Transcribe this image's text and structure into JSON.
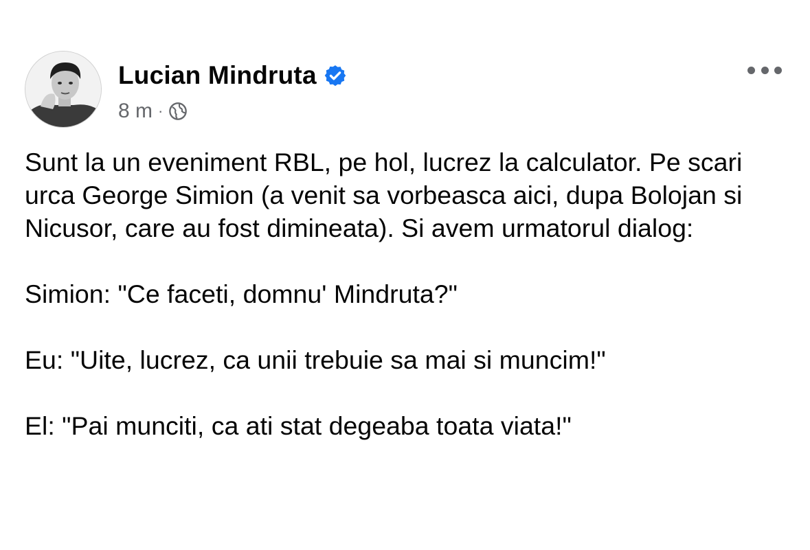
{
  "post": {
    "author": {
      "name": "Lucian Mindruta",
      "verified": true,
      "avatar_icon": "profile-photo"
    },
    "meta": {
      "time": "8 m",
      "separator": "·",
      "audience_icon": "globe-icon"
    },
    "more_icon": "more-options-icon",
    "paragraphs": [
      "Sunt la un eveniment RBL, pe hol, lucrez la calculator. Pe scari urca George Simion (a venit sa vorbeasca aici, dupa Bolojan si Nicusor, care au fost dimineata). Si avem urmatorul dialog:",
      "Simion: \"Ce faceti, domnu' Mindruta?\"",
      "Eu: \"Uite, lucrez, ca unii trebuie sa mai si muncim!\"",
      "El: \"Pai munciti, ca ati stat degeaba toata viata!\""
    ]
  },
  "colors": {
    "text": "#050505",
    "secondary": "#65676b",
    "verified_badge": "#1877f2",
    "background": "#ffffff"
  }
}
